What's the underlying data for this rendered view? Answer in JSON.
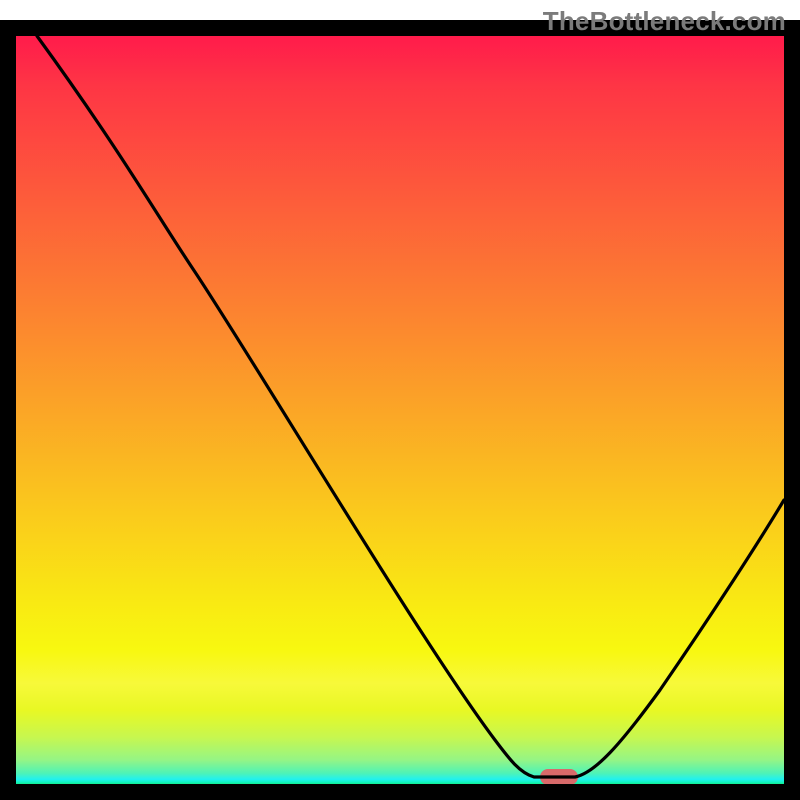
{
  "watermark": "TheBottleneck.com",
  "chart_data": {
    "type": "line",
    "title": "",
    "xlabel": "",
    "ylabel": "",
    "xlim": [
      0,
      100
    ],
    "ylim": [
      0,
      100
    ],
    "axes_visible": false,
    "curve_points_xy": [
      [
        3,
        100
      ],
      [
        23,
        73
      ],
      [
        63,
        6
      ],
      [
        68,
        1
      ],
      [
        74,
        1
      ],
      [
        100,
        42
      ]
    ],
    "flat_minimum_x_range": [
      66,
      75
    ],
    "marker": {
      "shape": "pill",
      "x": 71,
      "y": 1,
      "color": "#d86a6a"
    },
    "background_gradient_colors_top_to_bottom": [
      "#ff1b4b",
      "#fe3545",
      "#fc8330",
      "#fac41e",
      "#f9e913",
      "#f8f810",
      "#e8f824",
      "#95f585",
      "#21f1ef"
    ],
    "frame_color": "#000000"
  }
}
